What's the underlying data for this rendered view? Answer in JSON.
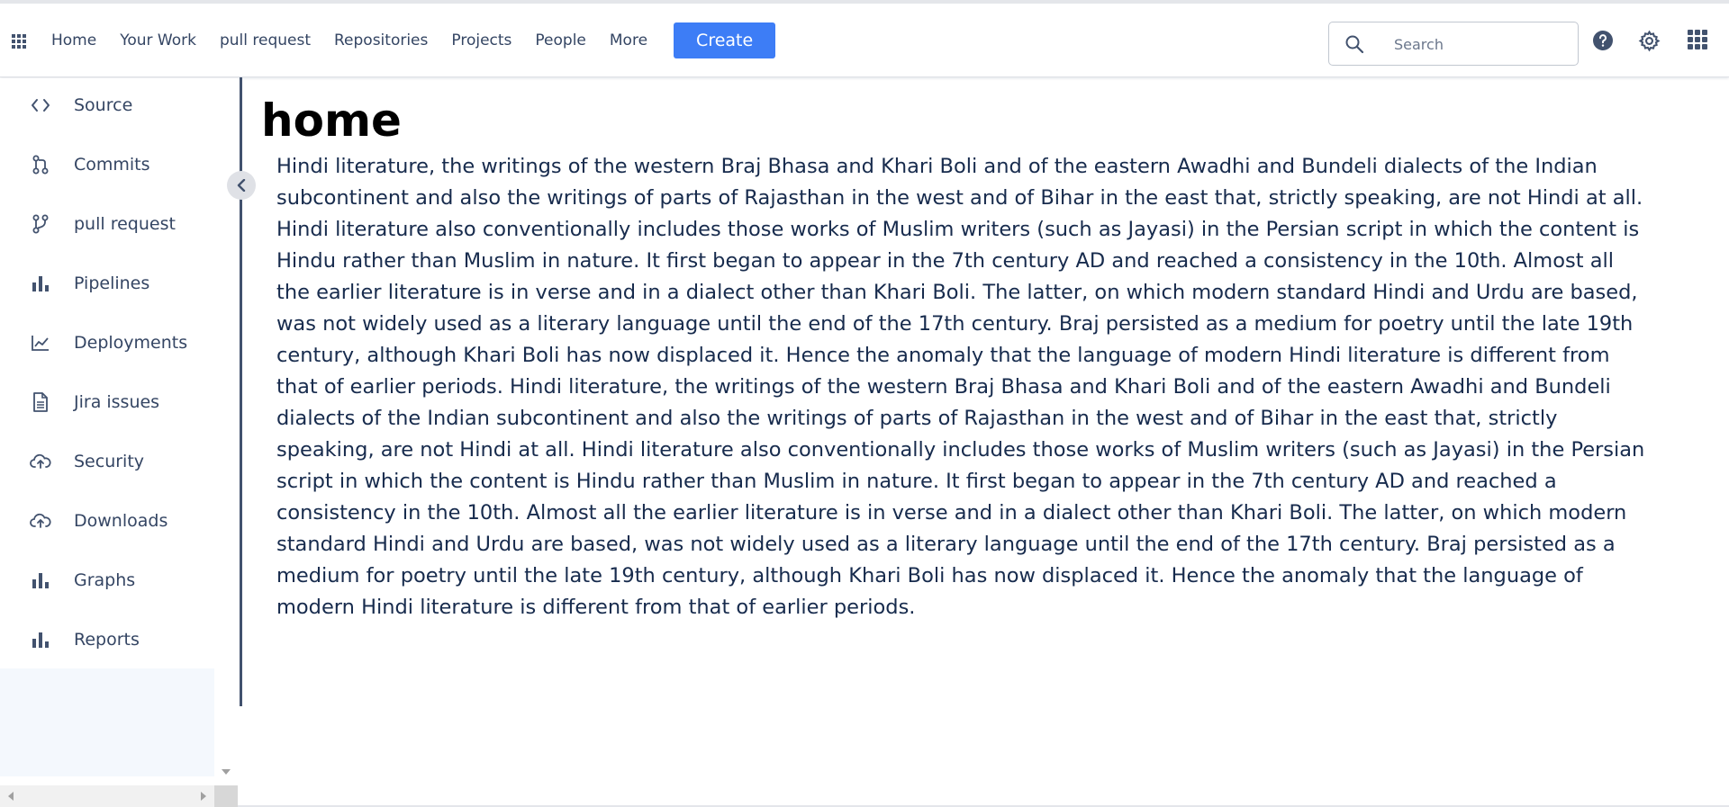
{
  "nav": {
    "items": [
      "Home",
      "Your Work",
      "pull request",
      "Repositories",
      "Projects",
      "People",
      "More"
    ],
    "create_label": "Create"
  },
  "search": {
    "placeholder": "Search",
    "value": ""
  },
  "sidebar": {
    "items": [
      {
        "label": "Source",
        "icon": "code-icon"
      },
      {
        "label": "Commits",
        "icon": "commit-icon"
      },
      {
        "label": "pull request",
        "icon": "pull-request-icon"
      },
      {
        "label": "Pipelines",
        "icon": "bar-chart-icon"
      },
      {
        "label": "Deployments",
        "icon": "line-chart-icon"
      },
      {
        "label": "Jira issues",
        "icon": "document-icon"
      },
      {
        "label": "Security",
        "icon": "cloud-upload-icon"
      },
      {
        "label": "Downloads",
        "icon": "cloud-upload-icon"
      },
      {
        "label": "Graphs",
        "icon": "bar-chart-icon"
      },
      {
        "label": "Reports",
        "icon": "bar-chart-icon"
      }
    ]
  },
  "page": {
    "title": "home",
    "body": "Hindi literature, the writings of the western Braj Bhasa and Khari Boli and of the eastern Awadhi and Bundeli dialects of the Indian subcontinent and also the writings of parts of Rajasthan in the west and of Bihar in the east that, strictly speaking, are not Hindi at all. Hindi literature also conventionally includes those works of Muslim writers (such as Jayasi) in the Persian script in which the content is Hindu rather than Muslim in nature. It first began to appear in the 7th century AD and reached a consistency in the 10th. Almost all the earlier literature is in verse and in a dialect other than Khari Boli. The latter, on which modern standard Hindi and Urdu are based, was not widely used as a literary language until the end of the 17th century. Braj persisted as a medium for poetry until the late 19th century, although Khari Boli has now displaced it. Hence the anomaly that the language of modern Hindi literature is different from that of earlier periods. Hindi literature, the writings of the western Braj Bhasa and Khari Boli and of the eastern Awadhi and Bundeli dialects of the Indian subcontinent and also the writings of parts of Rajasthan in the west and of Bihar in the east that, strictly speaking, are not Hindi at all. Hindi literature also conventionally includes those works of Muslim writers (such as Jayasi) in the Persian script in which the content is Hindu rather than Muslim in nature. It first began to appear in the 7th century AD and reached a consistency in the 10th. Almost all the earlier literature is in verse and in a dialect other than Khari Boli. The latter, on which modern standard Hindi and Urdu are based, was not widely used as a literary language until the end of the 17th century. Braj persisted as a medium for poetry until the late 19th century, although Khari Boli has now displaced it. Hence the anomaly that the language of modern Hindi literature is different from that of earlier periods."
  },
  "colors": {
    "accent": "#3d7df6",
    "nav_text": "#344563",
    "sidebar_fill": "#f4f8fd",
    "divider": "#42526e"
  }
}
